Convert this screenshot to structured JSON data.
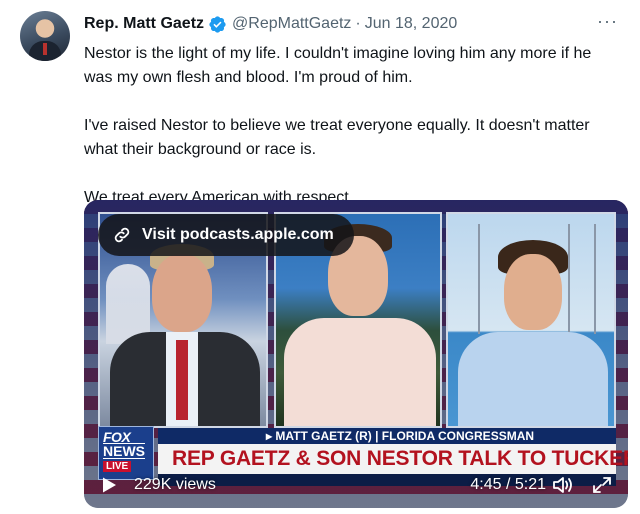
{
  "tweet": {
    "author": {
      "name": "Rep. Matt Gaetz",
      "handle": "@RepMattGaetz",
      "separator": "·",
      "date": "Jun 18, 2020"
    },
    "more_label": "···",
    "body": {
      "p1": "Nestor is the light of my life. I couldn't imagine loving him any more if he was my own flesh and blood. I'm proud of him.",
      "p2": "I've raised Nestor to believe we treat everyone equally. It doesn't matter what their background or race is.",
      "p3": "We treat every American with respect."
    }
  },
  "media": {
    "visit_label": "Visit podcasts.apple.com",
    "broadcast": {
      "logo_line1": "FOX",
      "logo_line2": "NEWS",
      "logo_line3": "LIVE",
      "lower_third_sub": "▸ MATT GAETZ (R) | FLORIDA CONGRESSMAN",
      "lower_third_main": "REP GAETZ & SON NESTOR TALK TO TUCKER"
    },
    "controls": {
      "views": "229K views",
      "time": "4:45 / 5:21"
    }
  },
  "icons": {
    "verified": "verified-badge-icon",
    "link": "link-icon",
    "play": "play-icon",
    "volume": "volume-icon",
    "expand": "expand-icon"
  },
  "colors": {
    "verified": "#1d9bf0",
    "secondary_text": "#536471",
    "primary_text": "#0f1419"
  }
}
